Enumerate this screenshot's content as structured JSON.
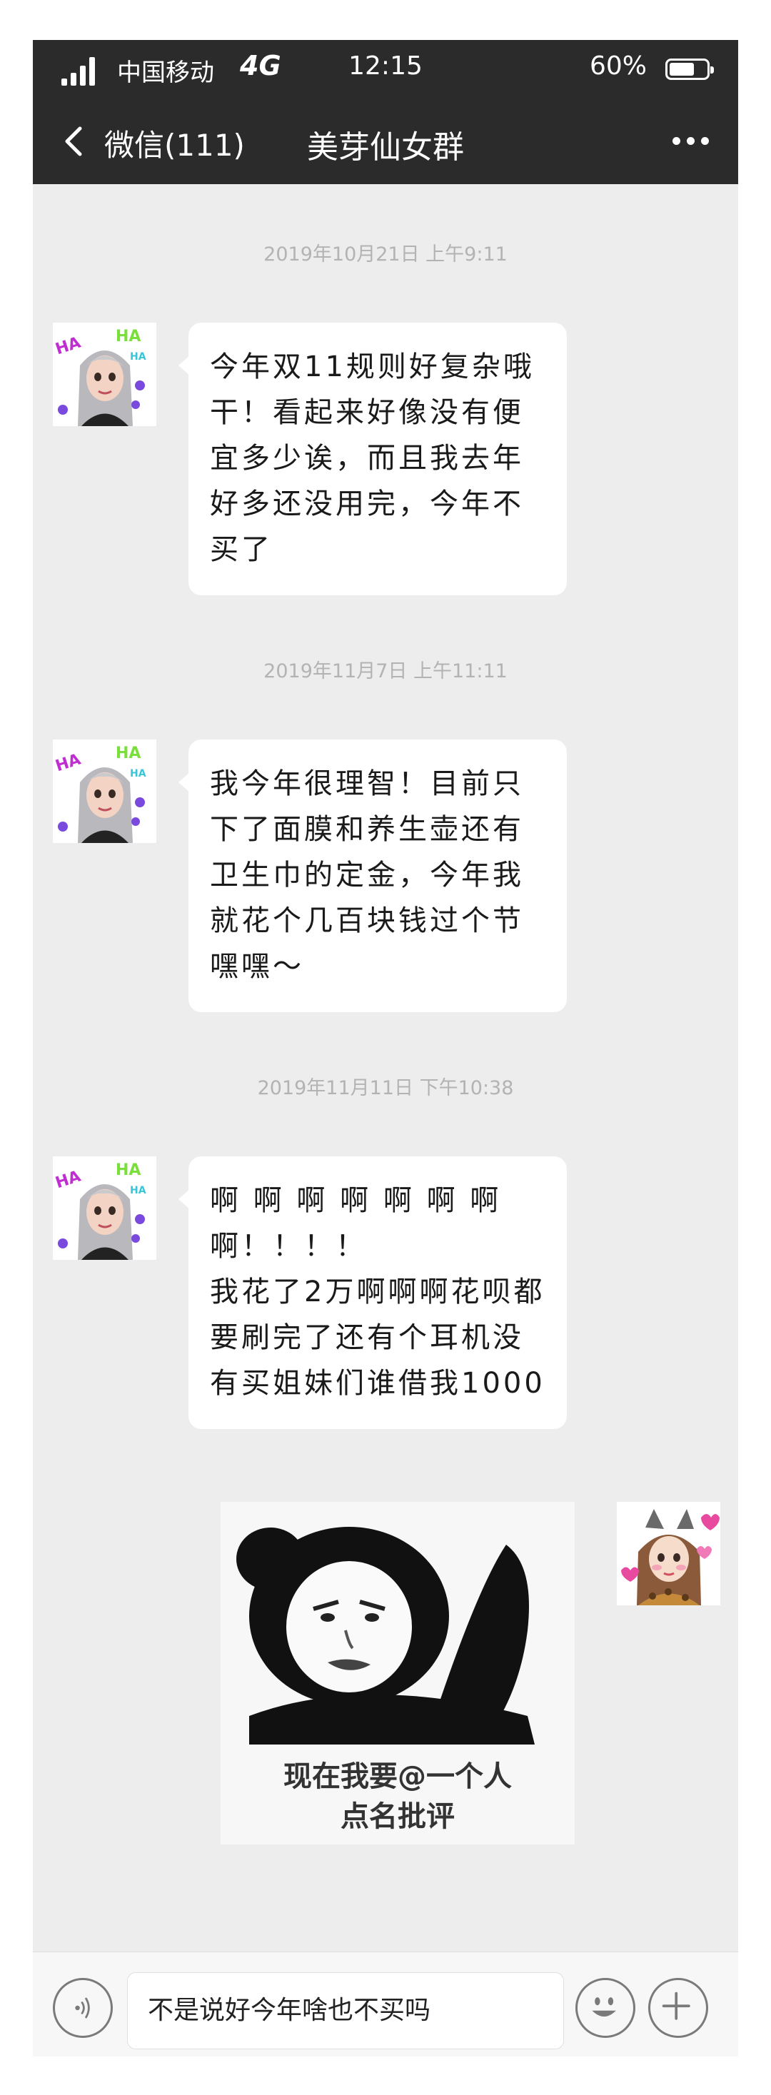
{
  "status_bar": {
    "carrier": "中国移动",
    "network": "4G",
    "time": "12:15",
    "battery": "60%",
    "battery_level": 0.6
  },
  "nav": {
    "back_label": "微信(111)",
    "title": "美芽仙女群"
  },
  "messages": [
    {
      "timestamp": "2019年10月21日 上午9:11",
      "text": "今年双11规则好复杂哦干！看起来好像没有便宜多少诶，而且我去年好多还没用完，今年不买了"
    },
    {
      "timestamp": "2019年11月7日 上午11:11",
      "text": "我今年很理智！目前只下了面膜和养生壶还有卫生巾的定金，今年我就花个几百块钱过个节嘿嘿～"
    },
    {
      "timestamp": "2019年11月11日 下午10:38",
      "text": "啊 啊 啊 啊 啊 啊 啊\n啊！！！！\n我花了2万啊啊啊花呗都要刷完了还有个耳机没有买姐妹们谁借我1000"
    }
  ],
  "meme": {
    "caption_line1": "现在我要@一个人",
    "caption_line2": "点名批评"
  },
  "input": {
    "value": "不是说好今年啥也不买吗"
  },
  "colors": {
    "header_bg": "#2b2b2b",
    "chat_bg": "#ededed",
    "bubble_bg": "#ffffff",
    "stamp_text": "#b3b3b3"
  }
}
